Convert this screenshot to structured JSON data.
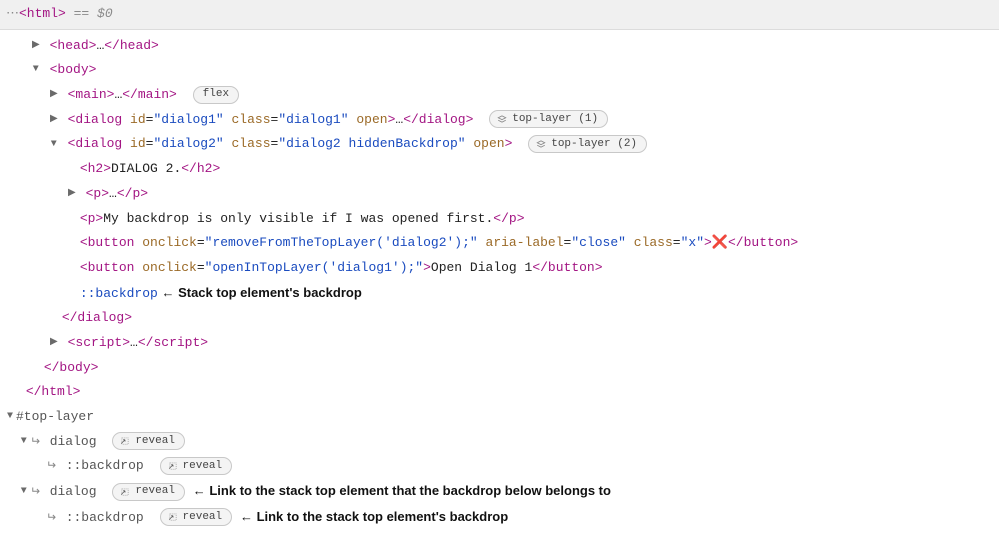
{
  "breadcrumb": {
    "dots": "⋯",
    "html_open": "<html>",
    "equals": " == ",
    "dollar": "$0"
  },
  "tree": {
    "head": {
      "open": "<head>",
      "ellipsis": "…",
      "close": "</head>"
    },
    "body": {
      "open": "<body>",
      "main": {
        "open": "<main>",
        "ellipsis": "…",
        "close": "</main>",
        "badge": "flex"
      },
      "dialog1": {
        "prefix": "<dialog",
        "id_attr": "id",
        "id_val": "\"dialog1\"",
        "class_attr": "class",
        "class_val": "\"dialog1\"",
        "open_attr": "open",
        "suffix": ">",
        "ellipsis": "…",
        "close": "</dialog>",
        "badge": "top-layer (1)"
      },
      "dialog2": {
        "prefix": "<dialog",
        "id_attr": "id",
        "id_val": "\"dialog2\"",
        "class_attr": "class",
        "class_val": "\"dialog2 hiddenBackdrop\"",
        "open_attr": "open",
        "suffix": ">",
        "badge": "top-layer (2)",
        "h2": {
          "open": "<h2>",
          "text": "DIALOG 2.",
          "close": "</h2>"
        },
        "p1": {
          "open": "<p>",
          "ellipsis": "…",
          "close": "</p>"
        },
        "p2": {
          "open": "<p>",
          "text": "My backdrop is only visible if I was opened first.",
          "close": "</p>"
        },
        "btn1": {
          "prefix": "<button",
          "onclick_attr": "onclick",
          "onclick_val": "\"removeFromTheTopLayer('dialog2');\"",
          "aria_attr": "aria-label",
          "aria_val": "\"close\"",
          "class_attr": "class",
          "class_val": "\"x\"",
          "suffix": ">",
          "text": "❌",
          "close": "</button>"
        },
        "btn2": {
          "prefix": "<button",
          "onclick_attr": "onclick",
          "onclick_val": "\"openInTopLayer('dialog1');\"",
          "suffix": ">",
          "text": "Open Dialog 1",
          "close": "</button>"
        },
        "backdrop": {
          "selector": "::backdrop",
          "arrow": " ← ",
          "annotation": "Stack top element's backdrop"
        },
        "close": "</dialog>"
      },
      "script": {
        "open": "<script>",
        "ellipsis": "…",
        "close": "</script>"
      },
      "close": "</body>"
    },
    "html_close": "</html>"
  },
  "toplayer": {
    "header": "#top-layer",
    "items": [
      {
        "name": "dialog",
        "badge": "reveal",
        "annotation": "",
        "backdrop": {
          "name": "::backdrop",
          "badge": "reveal",
          "annotation": ""
        }
      },
      {
        "name": "dialog",
        "badge": "reveal",
        "annotation": "Link to the stack top element that the backdrop below belongs to",
        "backdrop": {
          "name": "::backdrop",
          "badge": "reveal",
          "annotation": "Link to the stack top element's backdrop"
        }
      }
    ]
  },
  "glyphs": {
    "right": "▶",
    "down": "▼",
    "return": "↵",
    "arrow_left": "←"
  }
}
